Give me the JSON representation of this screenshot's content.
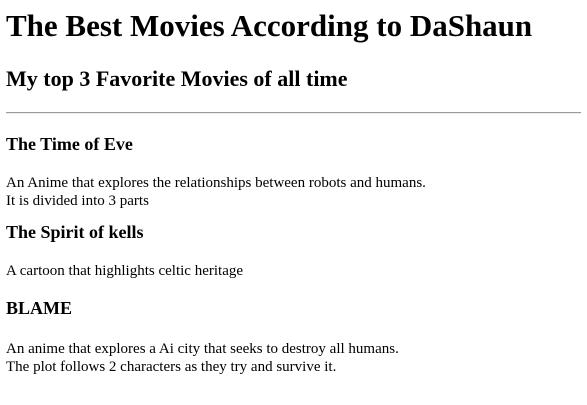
{
  "page": {
    "title": "The Best Movies According to DaShaun",
    "subtitle": "My top 3 Favorite Movies of all time"
  },
  "movies": [
    {
      "title": "The Time of Eve",
      "description_lines": [
        "An Anime that explores the relationships between robots and humans.",
        "It is divided into 3 parts"
      ]
    },
    {
      "title": "The Spirit of kells",
      "description_lines": [
        "A cartoon that highlights celtic heritage"
      ]
    },
    {
      "title": "BLAME",
      "description_lines": [
        "An anime that explores a Ai city that seeks to destroy all humans.",
        "The plot follows 2 characters as they try and survive it."
      ]
    }
  ]
}
